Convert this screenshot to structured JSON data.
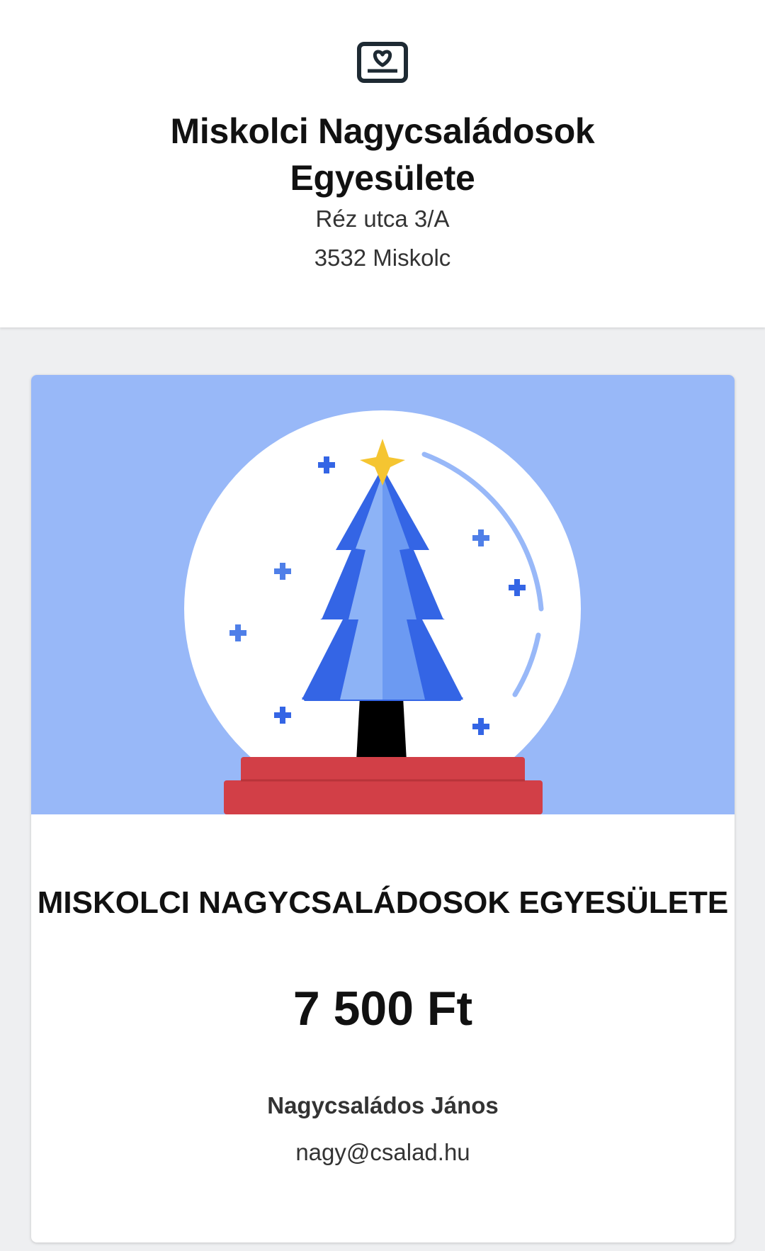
{
  "header": {
    "logo_icon": "heart-card-icon",
    "org_name": "Miskolci Nagycsaládosok Egyesülete",
    "address_line1": "Réz utca 3/A",
    "address_line2": "3532 Miskolc"
  },
  "card": {
    "illustration_icon": "christmas-tree-snow-globe-icon",
    "title": "MISKOLCI NAGYCSALÁDOSOK EGYESÜLETE",
    "amount": "7 500 Ft",
    "donor_name": "Nagycsaládos János",
    "donor_email": "nagy@csalad.hu"
  },
  "colors": {
    "illustration_background": "#98b8f8",
    "tree_dark_blue": "#3465e5",
    "tree_light_blue": "#8db3f6",
    "star_yellow": "#f5c531",
    "base_red": "#d23f47",
    "globe_white": "#ffffff",
    "page_background": "#eeeff1"
  }
}
